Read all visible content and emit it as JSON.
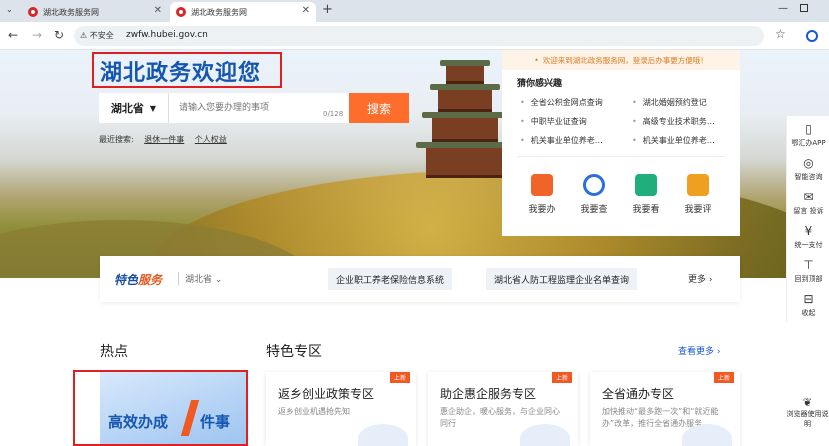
{
  "browser": {
    "tabs": [
      {
        "title": "湖北政务服务网",
        "active": false
      },
      {
        "title": "湖北政务服务网",
        "active": true
      }
    ],
    "insecure_label": "不安全",
    "url": "zwfw.hubei.gov.cn"
  },
  "hero": {
    "title": "湖北政务欢迎您",
    "region": "湖北省",
    "search_placeholder": "请输入您要办理的事项",
    "char_count": "0/128",
    "search_button": "搜索",
    "recent_label": "最近搜索:",
    "recent_items": [
      "退休一件事",
      "个人权益"
    ]
  },
  "panel": {
    "tip": "欢迎来到湖北政务服务网，登录后办事更方便哦！",
    "heading": "猜你感兴趣",
    "interests": [
      "全省公积金网点查询",
      "湖北婚姻预约登记",
      "中职毕业证查询",
      "高级专业技术职务…",
      "机关事业单位养老…",
      "机关事业单位养老…"
    ],
    "quick_actions": [
      {
        "label": "我要办",
        "icon": "apply-icon",
        "color": "#f0642a"
      },
      {
        "label": "我要查",
        "icon": "query-icon",
        "color": "#2a6ee0"
      },
      {
        "label": "我要看",
        "icon": "view-icon",
        "color": "#1fae7c"
      },
      {
        "label": "我要评",
        "icon": "rate-icon",
        "color": "#f0a020"
      }
    ]
  },
  "rail": {
    "items": [
      {
        "label": "鄂汇办APP",
        "icon": "phone-icon",
        "glyph": "▯"
      },
      {
        "label": "智能咨询",
        "icon": "chat-icon",
        "glyph": "◎"
      },
      {
        "label": "留言 投诉",
        "icon": "message-icon",
        "glyph": "✉"
      },
      {
        "label": "统一支付",
        "icon": "payment-icon",
        "glyph": "¥"
      },
      {
        "label": "回到顶部",
        "icon": "back-to-top-icon",
        "glyph": "⊤"
      },
      {
        "label": "收起",
        "icon": "collapse-icon",
        "glyph": "⊟"
      }
    ],
    "browser_help": "浏览器使用说明"
  },
  "features": {
    "logo_a": "特色",
    "logo_b": "服务",
    "region": "湖北省",
    "chips": [
      "企业职工养老保险信息系统",
      "湖北省人防工程监理企业名单查询"
    ],
    "more": "更多"
  },
  "hot": {
    "heading": "热点",
    "banner_a": "高效办成",
    "banner_b": "件事"
  },
  "special": {
    "heading": "特色专区",
    "view_more": "查看更多",
    "badge": "上新",
    "cards": [
      {
        "title": "返乡创业政策专区",
        "desc": "返乡创业机遇抢先知"
      },
      {
        "title": "助企惠企服务专区",
        "desc": "惠企助企，暖心服务，与企业同心同行"
      },
      {
        "title": "全省通办专区",
        "desc": "加快推动“最多跑一次”和“就近能办”改革，推行全省通办服务"
      }
    ]
  }
}
